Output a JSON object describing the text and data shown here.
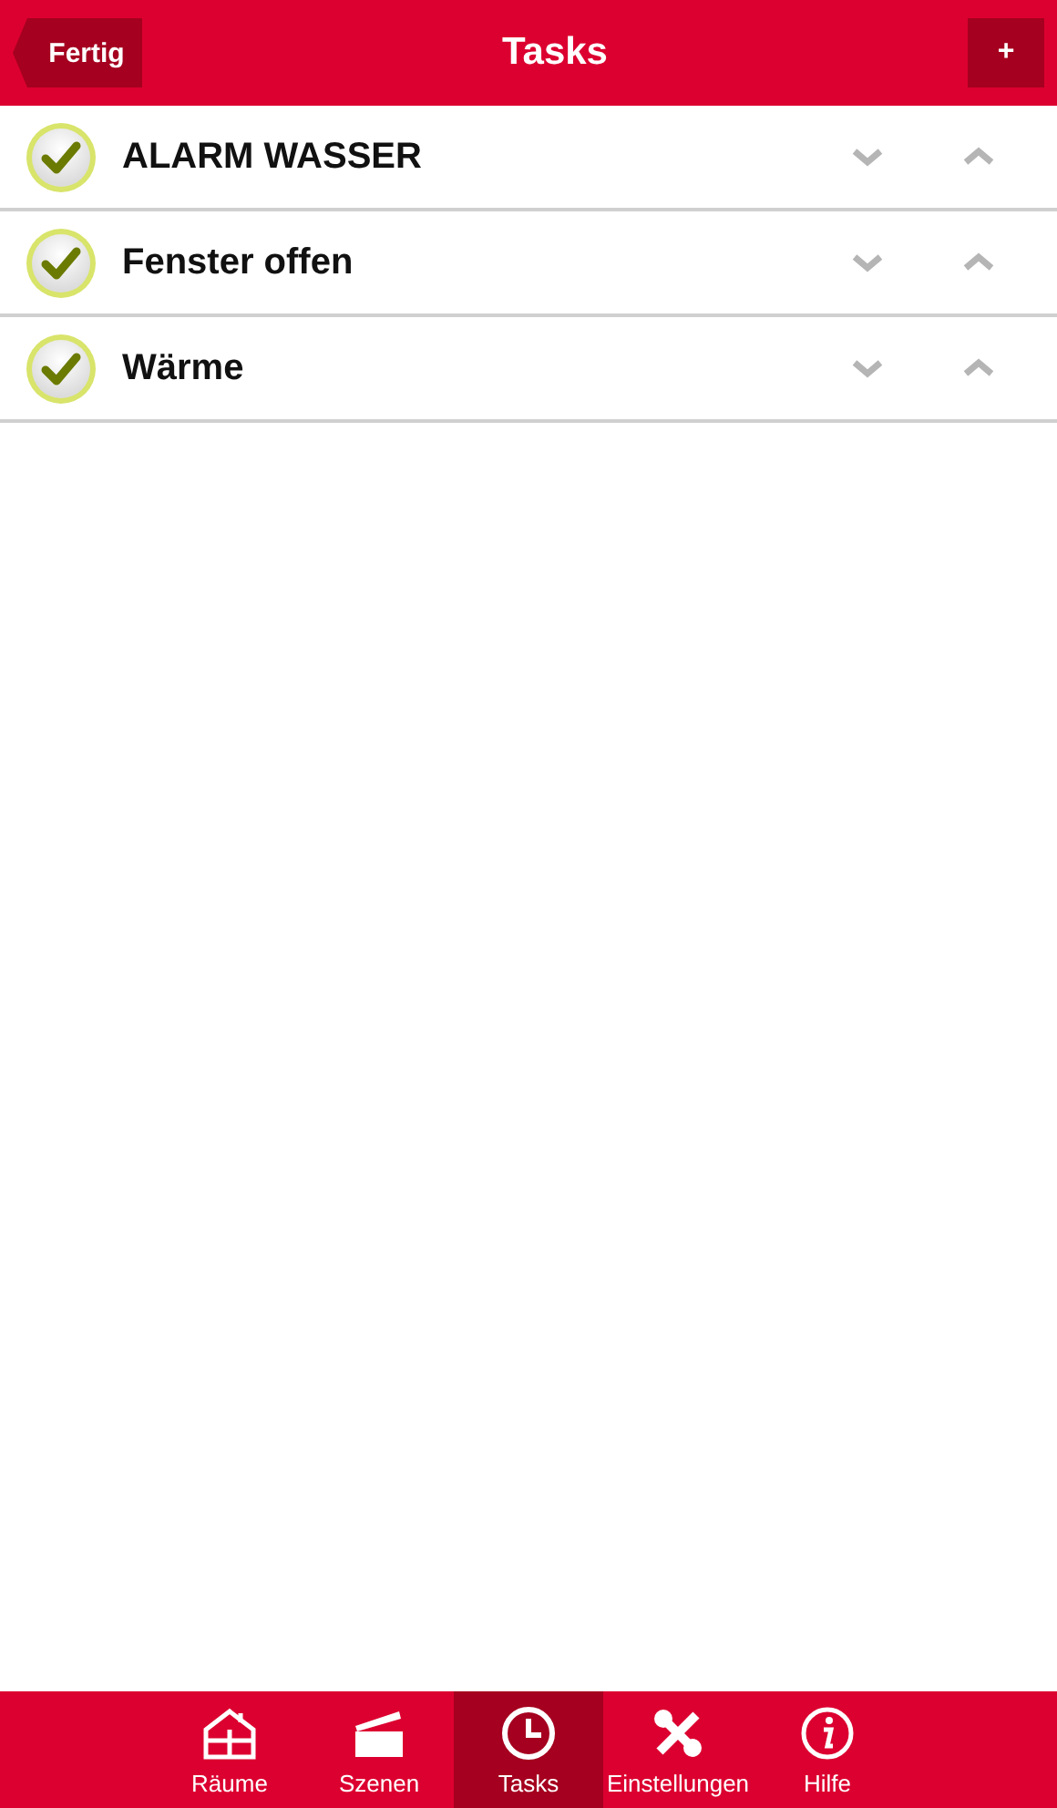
{
  "header": {
    "title": "Tasks",
    "back_button": "Fertig",
    "add_button": "+"
  },
  "tasks": [
    {
      "name": "ALARM WASSER",
      "checked": true
    },
    {
      "name": "Fenster offen",
      "checked": true
    },
    {
      "name": "Wärme",
      "checked": true
    }
  ],
  "tab_bar": [
    {
      "kind": "house",
      "label": "Räume",
      "selected": false
    },
    {
      "kind": "clapper",
      "label": "Szenen",
      "selected": false
    },
    {
      "kind": "clock",
      "label": "Tasks",
      "selected": true
    },
    {
      "kind": "tools",
      "label": "Einstellungen",
      "selected": false
    },
    {
      "kind": "info",
      "label": "Hilfe",
      "selected": false
    }
  ]
}
